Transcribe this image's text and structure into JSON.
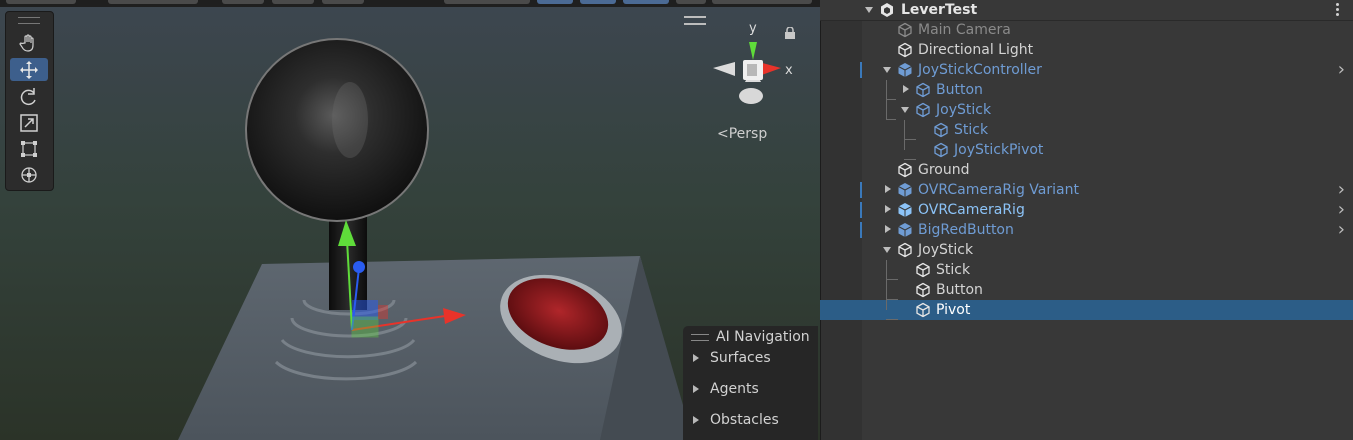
{
  "scene": {
    "persp_label": "Persp",
    "gizmo": {
      "y_label": "y",
      "x_label": "x"
    },
    "tools": [
      {
        "name": "hand-tool",
        "icon": "hand-icon",
        "active": false
      },
      {
        "name": "move-tool",
        "icon": "move-icon",
        "active": true
      },
      {
        "name": "rotate-tool",
        "icon": "rotate-icon",
        "active": false
      },
      {
        "name": "scale-tool",
        "icon": "scale-icon",
        "active": false
      },
      {
        "name": "rect-tool",
        "icon": "rect-icon",
        "active": false
      },
      {
        "name": "transform-tool",
        "icon": "transform-icon",
        "active": false
      }
    ],
    "ai_navigation": {
      "title": "AI Navigation",
      "items": [
        "Surfaces",
        "Agents",
        "Obstacles"
      ]
    }
  },
  "hierarchy": {
    "scene_name": "LeverTest",
    "items": [
      {
        "label": "Main Camera",
        "depth": 0,
        "style": "dim",
        "expand": "none"
      },
      {
        "label": "Directional Light",
        "depth": 0,
        "style": "normal",
        "expand": "none"
      },
      {
        "label": "JoyStickController",
        "depth": 0,
        "style": "prefab",
        "expand": "open",
        "marker": true,
        "chevron": true
      },
      {
        "label": "Button",
        "depth": 1,
        "style": "prefab",
        "expand": "closed"
      },
      {
        "label": "JoyStick",
        "depth": 1,
        "style": "prefab",
        "expand": "open"
      },
      {
        "label": "Stick",
        "depth": 2,
        "style": "prefab",
        "expand": "none"
      },
      {
        "label": "JoyStickPivot",
        "depth": 2,
        "style": "prefab",
        "expand": "none"
      },
      {
        "label": "Ground",
        "depth": 0,
        "style": "normal",
        "expand": "none"
      },
      {
        "label": "OVRCameraRig Variant",
        "depth": 0,
        "style": "prefab",
        "expand": "closed",
        "marker": true,
        "chevron": true
      },
      {
        "label": "OVRCameraRig",
        "depth": 0,
        "style": "prefabbright",
        "expand": "closed",
        "marker": true,
        "chevron": true
      },
      {
        "label": "BigRedButton",
        "depth": 0,
        "style": "prefab",
        "expand": "closed",
        "marker": true,
        "chevron": true
      },
      {
        "label": "JoyStick",
        "depth": 0,
        "style": "normal",
        "expand": "open"
      },
      {
        "label": "Stick",
        "depth": 1,
        "style": "normal",
        "expand": "none"
      },
      {
        "label": "Button",
        "depth": 1,
        "style": "normal",
        "expand": "none"
      },
      {
        "label": "Pivot",
        "depth": 1,
        "style": "white",
        "expand": "none",
        "selected": true
      }
    ]
  },
  "colors": {
    "selection": "#2c5d87",
    "prefab_text": "#6f9cd4",
    "active_tool": "#3d5f8c",
    "axis_x": "#e8332a",
    "axis_y": "#5fdc3a",
    "axis_z": "#2a5cf0"
  }
}
